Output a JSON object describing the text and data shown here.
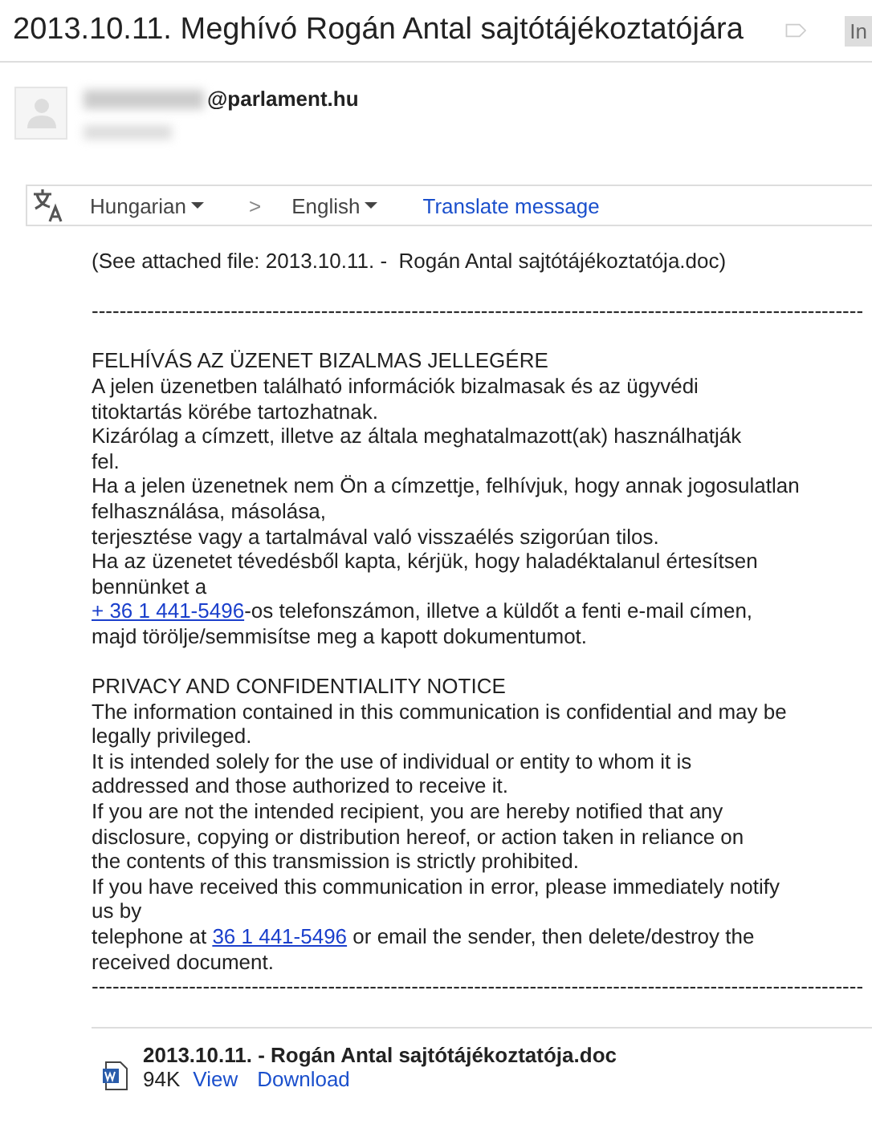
{
  "subject": "2013.10.11. Meghívó Rogán Antal sajtótájékoztatójára",
  "label_tag": "In",
  "sender": {
    "email": "@parlament.hu"
  },
  "translate": {
    "from": "Hungarian",
    "to": "English",
    "separator": ">",
    "action": "Translate message"
  },
  "body": [
    [
      [
        {
          "text": "(See attached file: 2013.10.11. -  Rogán Antal sajtótájékoztatója.doc)",
          "link": false
        }
      ]
    ],
    [
      [
        {
          "text": "---------------------------------------------------------------------------------------------------------------",
          "link": false
        }
      ]
    ],
    [
      [
        {
          "text": "FELHÍVÁS AZ ÜZENET BIZALMAS JELLEGÉRE",
          "link": false
        }
      ],
      [
        {
          "text": "A jelen üzenetben található információk bizalmasak és az ügyvédi",
          "link": false
        }
      ],
      [
        {
          "text": "titoktartás körébe tartozhatnak.",
          "link": false
        }
      ],
      [
        {
          "text": "Kizárólag a címzett, illetve az általa meghatalmazott(ak) használhatják",
          "link": false
        }
      ],
      [
        {
          "text": "fel.",
          "link": false
        }
      ],
      [
        {
          "text": "Ha a jelen üzenetnek nem Ön a címzettje, felhívjuk, hogy annak jogosulatlan",
          "link": false
        }
      ],
      [
        {
          "text": "felhasználása, másolása,",
          "link": false
        }
      ],
      [
        {
          "text": "terjesztése vagy a tartalmával való visszaélés szigorúan tilos.",
          "link": false
        }
      ],
      [
        {
          "text": "Ha az üzenetet tévedésből kapta, kérjük, hogy haladéktalanul értesítsen",
          "link": false
        }
      ],
      [
        {
          "text": "bennünket a",
          "link": false
        }
      ],
      [
        {
          "text": "+ 36 1 441-5496",
          "link": true
        },
        {
          "text": "-os telefonszámon, illetve a küldőt a fenti e-mail címen,",
          "link": false
        }
      ],
      [
        {
          "text": "majd törölje/semmisítse meg a kapott dokumentumot.",
          "link": false
        }
      ]
    ],
    [
      [
        {
          "text": "PRIVACY AND CONFIDENTIALITY NOTICE",
          "link": false
        }
      ],
      [
        {
          "text": "The information contained in this communication is confidential and may be",
          "link": false
        }
      ],
      [
        {
          "text": "legally privileged.",
          "link": false
        }
      ],
      [
        {
          "text": "It is intended solely for the use of individual or entity to whom it is",
          "link": false
        }
      ],
      [
        {
          "text": "addressed and those authorized to receive it.",
          "link": false
        }
      ],
      [
        {
          "text": "If you are not the intended recipient, you are hereby notified that any",
          "link": false
        }
      ],
      [
        {
          "text": "disclosure, copying or distribution hereof, or action taken in reliance on",
          "link": false
        }
      ],
      [
        {
          "text": "the contents of this transmission is strictly prohibited.",
          "link": false
        }
      ],
      [
        {
          "text": "If you have received this communication in error, please immediately notify",
          "link": false
        }
      ],
      [
        {
          "text": "us by",
          "link": false
        }
      ],
      [
        {
          "text": "telephone at ",
          "link": false
        },
        {
          "text": "36 1 441-5496",
          "link": true
        },
        {
          "text": " or email the sender, then delete/destroy the",
          "link": false
        }
      ],
      [
        {
          "text": "received document.",
          "link": false
        }
      ],
      [
        {
          "text": "---------------------------------------------------------------------------------------------------------------",
          "link": false
        }
      ]
    ]
  ],
  "attachment": {
    "name": "2013.10.11. - Rogán Antal sajtótájékoztatója.doc",
    "size": "94K",
    "actions": [
      "View",
      "Download"
    ]
  }
}
